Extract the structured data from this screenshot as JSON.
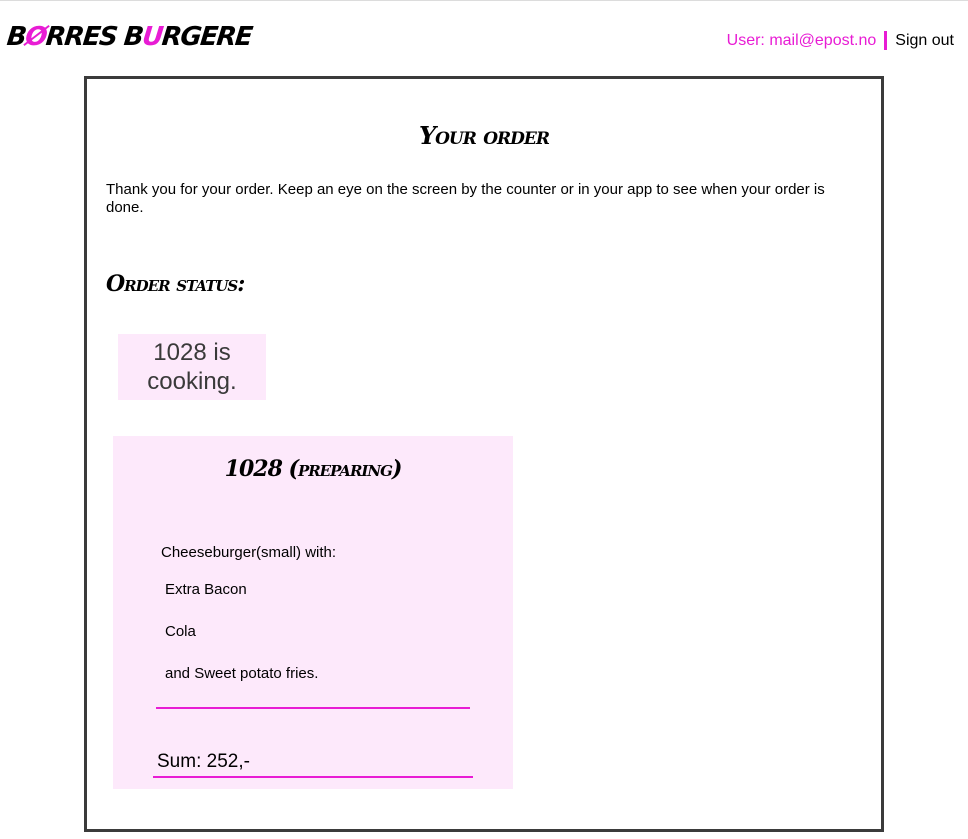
{
  "header": {
    "logo_part1": "B",
    "logo_accent1": "Ø",
    "logo_part2": "RRES B",
    "logo_accent2": "U",
    "logo_part3": "RGERE",
    "user_label": "User: mail@epost.no",
    "signout_label": "Sign out"
  },
  "main": {
    "title": "Your order",
    "intro": "Thank you for your order. Keep an eye on the screen by the counter or in your app to see when your order is done.",
    "status_heading": "Order status:",
    "status_text": "1028 is cooking."
  },
  "order": {
    "title": "1028 (preparing)",
    "item_main": "Cheeseburger(small) with:",
    "extras": [
      "Extra Bacon",
      "Cola",
      "and Sweet potato fries."
    ],
    "sum": "Sum: 252,-"
  },
  "colors": {
    "accent": "#e81cd4",
    "card_bg": "#fde9fb",
    "panel_border": "#3b3b3b"
  }
}
